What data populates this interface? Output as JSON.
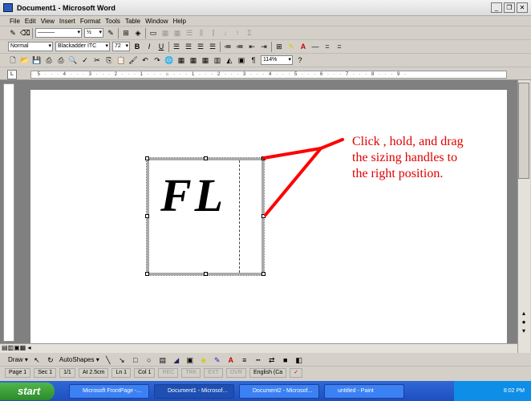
{
  "window": {
    "title": "Document1 - Microsoft Word"
  },
  "menu": [
    "File",
    "Edit",
    "View",
    "Insert",
    "Format",
    "Tools",
    "Table",
    "Window",
    "Help"
  ],
  "toolbar": {
    "line_weight": "½",
    "style": "Normal",
    "font": "Blackadder ITC",
    "size": "72",
    "bold": "B",
    "italic": "I",
    "underline": "U",
    "zoom": "114%"
  },
  "document": {
    "textbox_text": "FL",
    "annotation": "Click , hold, and drag\nthe sizing handles to\nthe right position.",
    "annotation_color": "#e00000"
  },
  "ruler": {
    "marks": "· 5 · · · 4 · · · 3 · · · 2 · · · 1 · · · ⌂ · · · 1 · · · 2 · · · 3 · · · 4 · · · 5 · · · 6 · · · 7 · · · 8 · · · 9 ·"
  },
  "drawing": {
    "draw": "Draw ▾",
    "autoshapes": "AutoShapes ▾"
  },
  "status": {
    "page": "Page 1",
    "sec": "Sec 1",
    "pages": "1/1",
    "at": "At 2.5cm",
    "ln": "Ln 1",
    "col": "Col 1",
    "rec": "REC",
    "trk": "TRK",
    "ext": "EXT",
    "ovr": "OVR",
    "lang": "English (Ca"
  },
  "taskbar": {
    "start": "start",
    "tasks": [
      "Microsoft FrontPage -...",
      "Document1 - Microsof...",
      "Document2 - Microsof...",
      "untitled - Paint"
    ],
    "clock": "8:02 PM"
  }
}
